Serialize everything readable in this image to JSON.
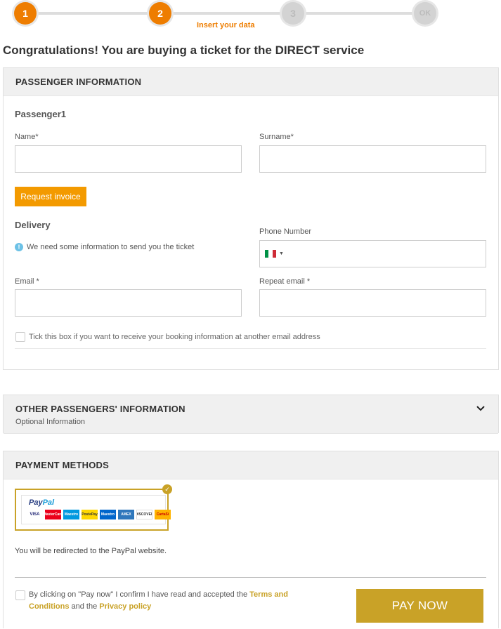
{
  "stepper": {
    "steps": [
      "1",
      "2",
      "3",
      "OK"
    ],
    "current_label": "Insert your data"
  },
  "page_title": "Congratulations! You are buying a ticket for the DIRECT service",
  "passenger_panel": {
    "title": "PASSENGER INFORMATION",
    "passenger_heading": "Passenger1",
    "name_label": "Name*",
    "surname_label": "Surname*",
    "invoice_button": "Request invoice",
    "delivery_heading": "Delivery",
    "delivery_info": "We need some information to send you the ticket",
    "phone_label": "Phone Number",
    "email_label": "Email *",
    "repeat_email_label": "Repeat email *",
    "other_email_checkbox": "Tick this box if you want to receive your booking information at another email address"
  },
  "other_passengers_panel": {
    "title": "OTHER PASSENGERS' INFORMATION",
    "subtitle": "Optional Information"
  },
  "payment_panel": {
    "title": "PAYMENT METHODS",
    "paypal_logo_pay": "Pay",
    "paypal_logo_pal": "Pal",
    "cards": [
      "VISA",
      "MasterCard",
      "Maestro",
      "PostePay",
      "Maestro",
      "AMEX",
      "DISCOVER",
      "CartaSi"
    ],
    "redirect_note": "You will be redirected to the PayPal website."
  },
  "footer": {
    "terms_prefix": "By clicking on \"Pay now\" I confirm I have read and accepted the ",
    "terms_link": "Terms and Conditions",
    "terms_mid": " and the ",
    "privacy_link": "Privacy policy",
    "pay_button": "PAY NOW"
  },
  "colors": {
    "accent_orange": "#ee7d00",
    "invoice_orange": "#f39a00",
    "gold": "#c9a227",
    "panel_header_bg": "#f0f0f0"
  },
  "icons": {
    "info": "info-icon",
    "chevron": "chevron-down-icon",
    "flag": "italy-flag-icon",
    "check": "check-icon"
  }
}
